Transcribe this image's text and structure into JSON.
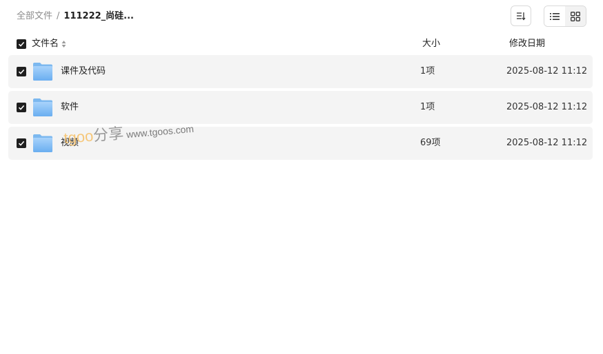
{
  "breadcrumb": {
    "root": "全部文件",
    "separator": "/",
    "current": "111222_尚硅..."
  },
  "toolbar": {
    "sort_icon": "sort-icon",
    "list_view_icon": "list-view-icon",
    "grid_view_icon": "grid-view-icon"
  },
  "table": {
    "headers": {
      "name": "文件名",
      "size": "大小",
      "date": "修改日期"
    },
    "rows": [
      {
        "name": "课件及代码",
        "size": "1项",
        "date": "2025-08-12 11:12",
        "icon": "folder-icon"
      },
      {
        "name": "软件",
        "size": "1项",
        "date": "2025-08-12 11:12",
        "icon": "folder-icon"
      },
      {
        "name": "视频",
        "size": "69项",
        "date": "2025-08-12 11:12",
        "icon": "folder-icon"
      }
    ]
  },
  "watermark": {
    "brand": "tgoo",
    "cn": "分享",
    "url": "www.tgoos.com"
  },
  "colors": {
    "checkbox": "#1f1f1f",
    "row_background": "#f4f4f4",
    "folder": "#7fb8f0"
  }
}
